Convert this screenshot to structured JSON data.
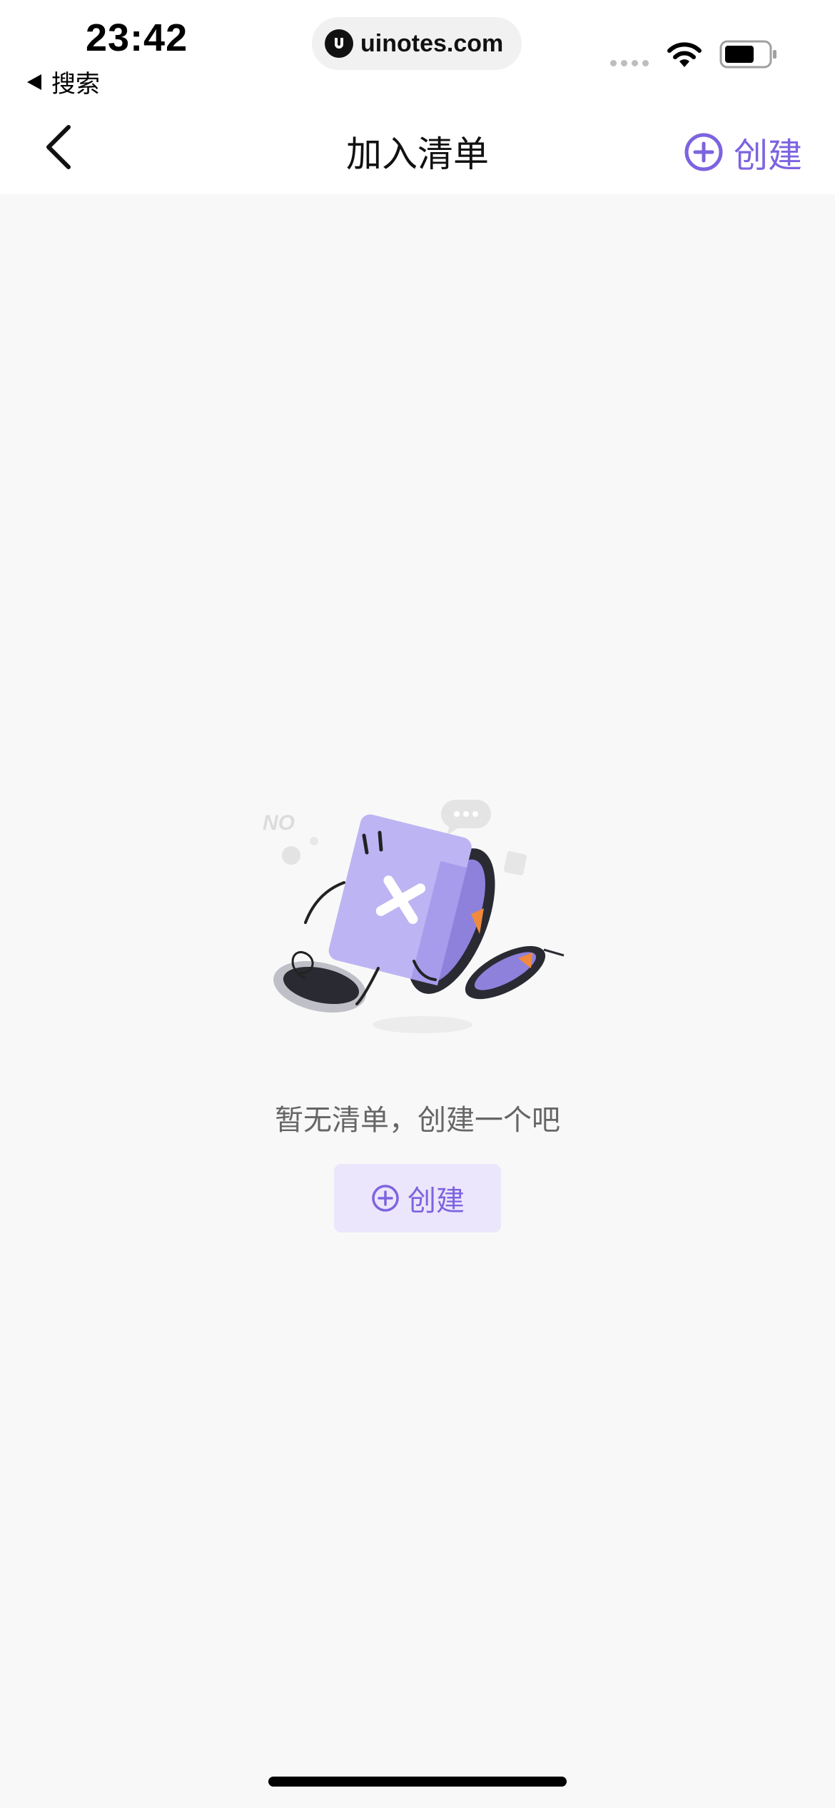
{
  "status_bar": {
    "time": "23:42",
    "back_app": "搜索",
    "url": "uinotes.com"
  },
  "nav": {
    "title": "加入清单",
    "create_label": "创建"
  },
  "empty_state": {
    "illustration_text": "NO",
    "message": "暂无清单，创建一个吧",
    "button_label": "创建"
  },
  "colors": {
    "accent": "#7d63e0",
    "button_bg": "#ebe6fb",
    "background": "#f8f8f8"
  },
  "icons": [
    "chevron-left-icon",
    "plus-circle-icon",
    "wifi-icon",
    "battery-icon",
    "site-logo-icon"
  ]
}
